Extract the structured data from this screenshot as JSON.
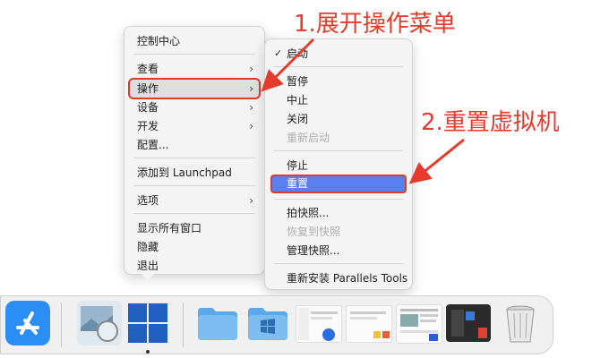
{
  "main_menu": {
    "items": [
      {
        "label": "控制中心"
      },
      {
        "label": "查看",
        "submenu": true
      },
      {
        "label": "操作",
        "submenu": true
      },
      {
        "label": "设备",
        "submenu": true
      },
      {
        "label": "开发",
        "submenu": true
      },
      {
        "label": "配置..."
      },
      {
        "label": "添加到 Launchpad"
      },
      {
        "label": "选项",
        "submenu": true
      },
      {
        "label": "显示所有窗口"
      },
      {
        "label": "隐藏"
      },
      {
        "label": "退出"
      }
    ]
  },
  "sub_menu": {
    "items": [
      {
        "label": "启动",
        "checked": true
      },
      {
        "label": "暂停"
      },
      {
        "label": "中止"
      },
      {
        "label": "关闭"
      },
      {
        "label": "重新启动",
        "disabled": true
      },
      {
        "label": "停止"
      },
      {
        "label": "重置",
        "highlighted": true
      },
      {
        "label": "拍快照..."
      },
      {
        "label": "恢复到快照",
        "disabled": true
      },
      {
        "label": "管理快照..."
      },
      {
        "label": "重新安装 Parallels Tools"
      }
    ]
  },
  "annotations": {
    "step1": "1.展开操作菜单",
    "step2": "2.重置虚拟机"
  },
  "colors": {
    "annotation_red": "#e53a2c",
    "highlight_blue": "#5a7ff0",
    "windows_blue": "#1f5fbf"
  },
  "dock": {
    "icons": [
      "app-store-icon",
      "preview-icon",
      "windows-vm-icon",
      "folder-icon",
      "windows-folder-icon",
      "finder-window-thumbnail",
      "window-thumbnail",
      "document-thumbnail",
      "app-thumbnail",
      "trash-icon"
    ]
  }
}
